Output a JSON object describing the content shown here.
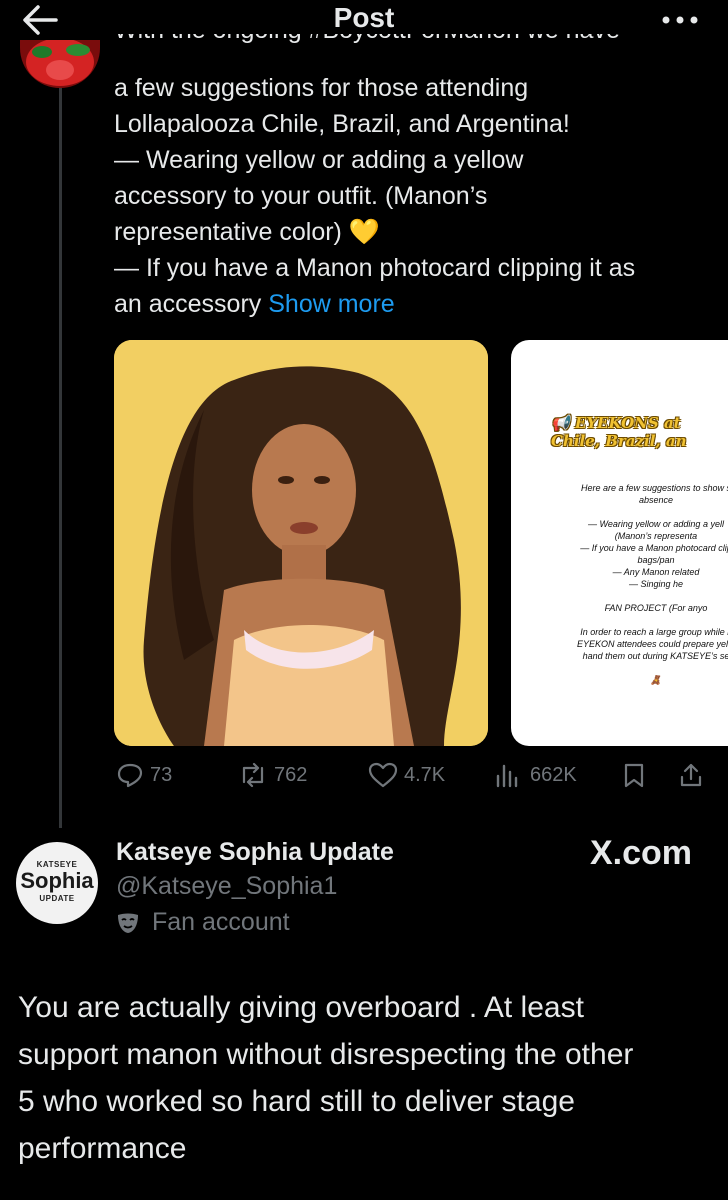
{
  "header": {
    "title": "Post",
    "back_icon": "arrow-left-icon",
    "more_icon": "more-horizontal-icon"
  },
  "tweet": {
    "text_partial_top": "With the ongoing #BoycottForManon we have",
    "text_lines": [
      "a few suggestions for those attending",
      "Lollapalooza Chile, Brazil, and Argentina!",
      "— Wearing yellow or adding a yellow",
      "accessory to your outfit. (Manon’s",
      "representative color) 💛",
      "— If you have a Manon photocard clipping it as"
    ],
    "text_last_line": "an accessory",
    "show_more": "Show more",
    "flyer": {
      "title_line1": "📢 EYEKONS at",
      "title_line2": "Chile, Brazil, an",
      "lines": [
        "Here are a few suggestions to show s",
        "absence",
        "",
        "— Wearing yellow or adding a yell",
        "(Manon’s representa",
        "— If you have a Manon photocard clip",
        "bags/pan",
        "— Any Manon related",
        "— Singing he",
        "",
        "FAN PROJECT (For anyo",
        "",
        "In order to reach a large group while k",
        "EYEKON attendees could prepare yello",
        "hand them out during KATSEYE’s se",
        "",
        "🧸"
      ]
    },
    "actions": {
      "replies": "73",
      "reposts": "762",
      "likes": "4.7K",
      "views": "662K"
    }
  },
  "quoted_account": {
    "avatar_top": "KATSEYE",
    "avatar_main": "Sophia",
    "avatar_bottom": "UPDATE",
    "name": "Katseye Sophia Update",
    "handle": "@Katseye_Sophia1",
    "label": "Fan account",
    "watermark": "X.com"
  },
  "reply": {
    "text_lines": [
      "You are actually giving overboard . At least",
      "support manon without disrespecting the other",
      "5 who worked so hard still to deliver stage",
      "performance"
    ]
  },
  "colors": {
    "background": "#000000",
    "text": "#e7e9ea",
    "muted": "#71767b",
    "link": "#1d9bf0",
    "photo_bg": "#f2cf62"
  }
}
